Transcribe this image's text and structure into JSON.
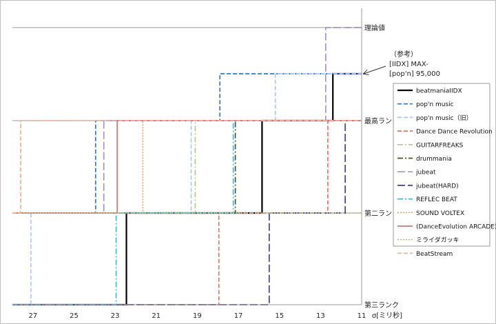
{
  "chart_data": {
    "type": "line",
    "x_label": "σ[ミリ秒]",
    "x_ticks": [
      27,
      25,
      23,
      21,
      19,
      17,
      15,
      13,
      11
    ],
    "xlim": [
      28.0,
      11.0
    ],
    "x_reversed": true,
    "y_categories": [
      "第三ランク",
      "第二ランク",
      "最高ランク",
      "理論値"
    ],
    "annotation": {
      "lines": [
        "（参考）",
        "[IIDX] MAX-",
        "[pop'n] 95,000"
      ]
    },
    "legend_position": "right",
    "series": [
      {
        "name": "beatmaniaIIDX",
        "color": "#000000",
        "dash": "solid",
        "steps": [
          [
            28.0,
            0
          ],
          [
            22.45,
            0
          ],
          [
            22.45,
            1
          ],
          [
            15.85,
            1
          ],
          [
            15.85,
            2
          ],
          [
            12.4,
            2
          ],
          [
            12.4,
            2.5
          ],
          [
            11.0,
            2.5
          ]
        ]
      },
      {
        "name": "pop'n music",
        "color": "#2e75d6",
        "dash": "dash",
        "steps": [
          [
            28.0,
            1
          ],
          [
            23.95,
            1
          ],
          [
            23.95,
            2
          ],
          [
            17.9,
            2
          ],
          [
            17.9,
            2.5
          ],
          [
            11.0,
            2.5
          ]
        ]
      },
      {
        "name": "pop'n music（旧）",
        "color": "#a9c8ef",
        "dash": "dash",
        "steps": [
          [
            28.0,
            0
          ],
          [
            27.1,
            0
          ],
          [
            27.1,
            1
          ],
          [
            19.3,
            1
          ],
          [
            19.3,
            2
          ],
          [
            15.2,
            2
          ],
          [
            15.2,
            2.5
          ],
          [
            11.0,
            2.5
          ]
        ]
      },
      {
        "name": "Dance Dance Revolution",
        "color": "#e07466",
        "dash": "dash",
        "steps": [
          [
            28.0,
            0
          ],
          [
            17.95,
            0
          ],
          [
            17.95,
            1
          ],
          [
            12.65,
            1
          ],
          [
            12.65,
            2
          ],
          [
            11.0,
            2
          ]
        ]
      },
      {
        "name": "GUITARFREAKS",
        "color": "#b7c98a",
        "dash": "dashdot",
        "steps": [
          [
            28.0,
            1
          ],
          [
            19.1,
            1
          ],
          [
            19.1,
            2
          ],
          [
            11.0,
            2
          ]
        ]
      },
      {
        "name": "drummania",
        "color": "#3b5d1e",
        "dash": "dashdot",
        "steps": [
          [
            28.0,
            1
          ],
          [
            17.15,
            1
          ],
          [
            17.15,
            2
          ],
          [
            11.0,
            2
          ]
        ]
      },
      {
        "name": "jubeat",
        "color": "#a391cc",
        "dash": "longdash",
        "steps": [
          [
            28.0,
            1
          ],
          [
            23.55,
            1
          ],
          [
            23.55,
            2
          ],
          [
            12.75,
            2
          ],
          [
            12.75,
            3
          ],
          [
            11.0,
            3
          ]
        ]
      },
      {
        "name": "jubeat(HARD)",
        "color": "#4a3c87",
        "dash": "longdash",
        "steps": [
          [
            28.0,
            0
          ],
          [
            15.5,
            0
          ],
          [
            15.5,
            1
          ],
          [
            11.8,
            1
          ],
          [
            11.8,
            2
          ],
          [
            11.0,
            2
          ]
        ]
      },
      {
        "name": "REFLEC BEAT",
        "color": "#4bb1d3",
        "dash": "dashdot",
        "steps": [
          [
            28.0,
            0
          ],
          [
            22.95,
            0
          ],
          [
            22.95,
            1
          ],
          [
            17.25,
            1
          ],
          [
            17.25,
            2
          ],
          [
            11.0,
            2
          ]
        ]
      },
      {
        "name": "SOUND VOLTEX",
        "color": "#f4a064",
        "dash": "dot",
        "steps": [
          [
            28.0,
            1
          ],
          [
            21.65,
            1
          ],
          [
            21.65,
            2
          ],
          [
            11.0,
            2
          ]
        ]
      },
      {
        "name": "(DanceEvolution ARCADE)",
        "color": "#c97b78",
        "dash": "solid",
        "steps": [
          [
            28.0,
            1
          ],
          [
            22.9,
            1
          ],
          [
            22.9,
            2
          ],
          [
            11.0,
            2
          ]
        ]
      },
      {
        "name": "ミライダガッキ",
        "color": "#aac382",
        "dash": "dot",
        "steps": [
          [
            28.0,
            1
          ],
          [
            11.0,
            1
          ]
        ]
      },
      {
        "name": "BeatStream",
        "color": "#f5b090",
        "dash": "dash",
        "steps": [
          [
            28.0,
            1
          ],
          [
            27.6,
            1
          ],
          [
            27.6,
            2
          ],
          [
            11.0,
            2
          ]
        ]
      }
    ]
  }
}
